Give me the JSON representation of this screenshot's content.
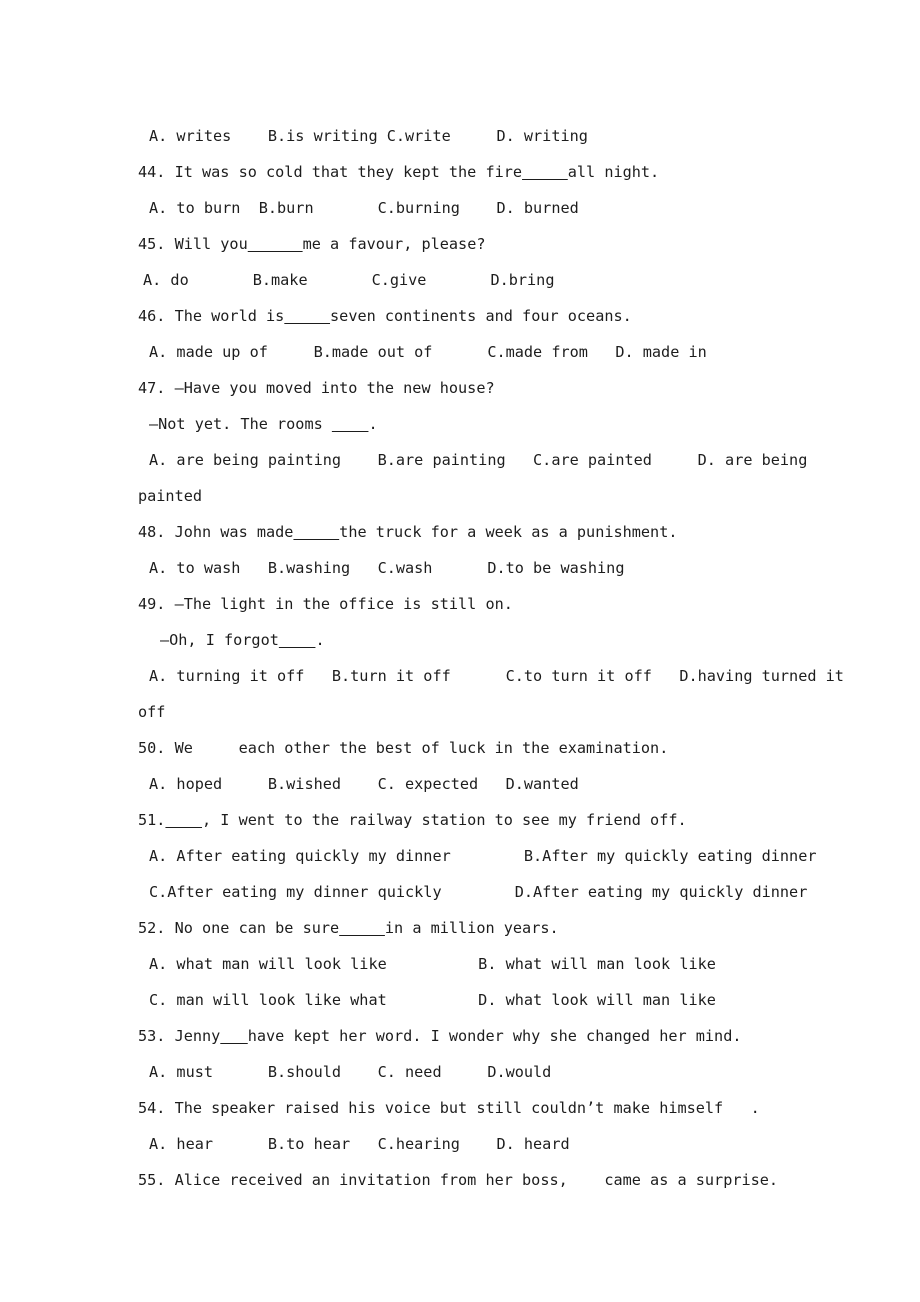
{
  "document": {
    "type": "english-grammar-multiple-choice-worksheet",
    "page_background": "#ffffff",
    "text_color": "#1d1d1d",
    "lines": [
      {
        "id": "l01",
        "kind": "options",
        "indent": "opt",
        "text": "A. writes    B.is writing C.write     D. writing"
      },
      {
        "id": "l02",
        "kind": "question",
        "indent": "q",
        "text": "44. It was so cold that they kept the fire_____all night."
      },
      {
        "id": "l03",
        "kind": "options",
        "indent": "opt",
        "text": "A. to burn  B.burn       C.burning    D. burned"
      },
      {
        "id": "l04",
        "kind": "question",
        "indent": "q",
        "text": "45. Will you______me a favour, please?"
      },
      {
        "id": "l05",
        "kind": "options",
        "indent": "opt-narrow",
        "text": "A. do       B.make       C.give       D.bring"
      },
      {
        "id": "l06",
        "kind": "question",
        "indent": "q",
        "text": "46. The world is_____seven continents and four oceans."
      },
      {
        "id": "l07",
        "kind": "options",
        "indent": "opt",
        "text": "A. made up of     B.made out of      C.made from   D. made in"
      },
      {
        "id": "l08",
        "kind": "question",
        "indent": "q",
        "text": "47. —Have you moved into the new house?"
      },
      {
        "id": "l09",
        "kind": "dialogue",
        "indent": "dlg2",
        "text": "—Not yet. The rooms ____."
      },
      {
        "id": "l10",
        "kind": "options",
        "indent": "opt",
        "text": "A. are being painting    B.are painting   C.are painted     D. are being"
      },
      {
        "id": "l11",
        "kind": "wrap",
        "indent": "cont",
        "text": "painted"
      },
      {
        "id": "l12",
        "kind": "question",
        "indent": "q",
        "text": "48. John was made_____the truck for a week as a punishment."
      },
      {
        "id": "l13",
        "kind": "options",
        "indent": "opt",
        "text": "A. to wash   B.washing   C.wash      D.to be washing"
      },
      {
        "id": "l14",
        "kind": "question",
        "indent": "q",
        "text": "49. —The light in the office is still on."
      },
      {
        "id": "l15",
        "kind": "dialogue",
        "indent": "dlg2b",
        "text": "—Oh, I forgot____."
      },
      {
        "id": "l16",
        "kind": "options",
        "indent": "opt",
        "text": "A. turning it off   B.turn it off      C.to turn it off   D.having turned it"
      },
      {
        "id": "l17",
        "kind": "wrap",
        "indent": "cont",
        "text": "off"
      },
      {
        "id": "l18",
        "kind": "question",
        "indent": "q",
        "text": "50. We     each other the best of luck in the examination."
      },
      {
        "id": "l19",
        "kind": "options",
        "indent": "opt",
        "text": "A. hoped     B.wished    C. expected   D.wanted"
      },
      {
        "id": "l20",
        "kind": "question",
        "indent": "q",
        "text": "51.____, I went to the railway station to see my friend off."
      },
      {
        "id": "l21",
        "kind": "options",
        "indent": "opt",
        "text": "A. After eating quickly my dinner        B.After my quickly eating dinner"
      },
      {
        "id": "l22",
        "kind": "options",
        "indent": "opt",
        "text": "C.After eating my dinner quickly        D.After eating my quickly dinner"
      },
      {
        "id": "l23",
        "kind": "question",
        "indent": "q",
        "text": "52. No one can be sure_____in a million years."
      },
      {
        "id": "l24",
        "kind": "options",
        "indent": "opt",
        "text": "A. what man will look like          B. what will man look like"
      },
      {
        "id": "l25",
        "kind": "options",
        "indent": "opt",
        "text": "C. man will look like what          D. what look will man like"
      },
      {
        "id": "l26",
        "kind": "question",
        "indent": "q",
        "text": "53. Jenny___have kept her word. I wonder why she changed her mind."
      },
      {
        "id": "l27",
        "kind": "options",
        "indent": "opt",
        "text": "A. must      B.should    C. need     D.would"
      },
      {
        "id": "l28",
        "kind": "question",
        "indent": "q",
        "text": "54. The speaker raised his voice but still couldn’t make himself   ."
      },
      {
        "id": "l29",
        "kind": "options",
        "indent": "opt",
        "text": "A. hear      B.to hear   C.hearing    D. heard"
      },
      {
        "id": "l30",
        "kind": "question",
        "indent": "q",
        "text": "55. Alice received an invitation from her boss,    came as a surprise."
      }
    ]
  }
}
